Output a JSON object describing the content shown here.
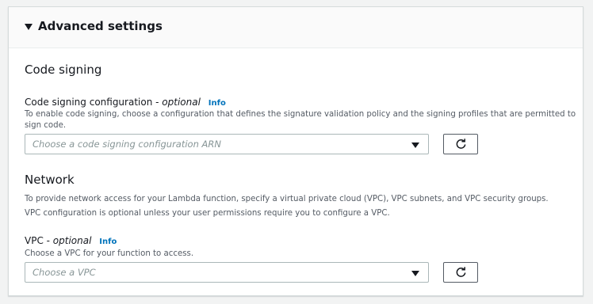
{
  "panel": {
    "title": "Advanced settings"
  },
  "code_signing": {
    "section_title": "Code signing",
    "label": "Code signing configuration - ",
    "optional": "optional",
    "info": "Info",
    "description": "To enable code signing, choose a configuration that defines the signature validation policy and the signing profiles that are permitted to sign code.",
    "select_placeholder": "Choose a code signing configuration ARN"
  },
  "network": {
    "section_title": "Network",
    "description": "To provide network access for your Lambda function, specify a virtual private cloud (VPC), VPC subnets, and VPC security groups. VPC configuration is optional unless your user permissions require you to configure a VPC.",
    "vpc_label": "VPC - ",
    "optional": "optional",
    "info": "Info",
    "vpc_description": "Choose a VPC for your function to access.",
    "select_placeholder": "Choose a VPC"
  },
  "colors": {
    "link": "#0073bb",
    "border": "#aab7b8",
    "muted_text": "#545b64",
    "placeholder": "#879596"
  }
}
